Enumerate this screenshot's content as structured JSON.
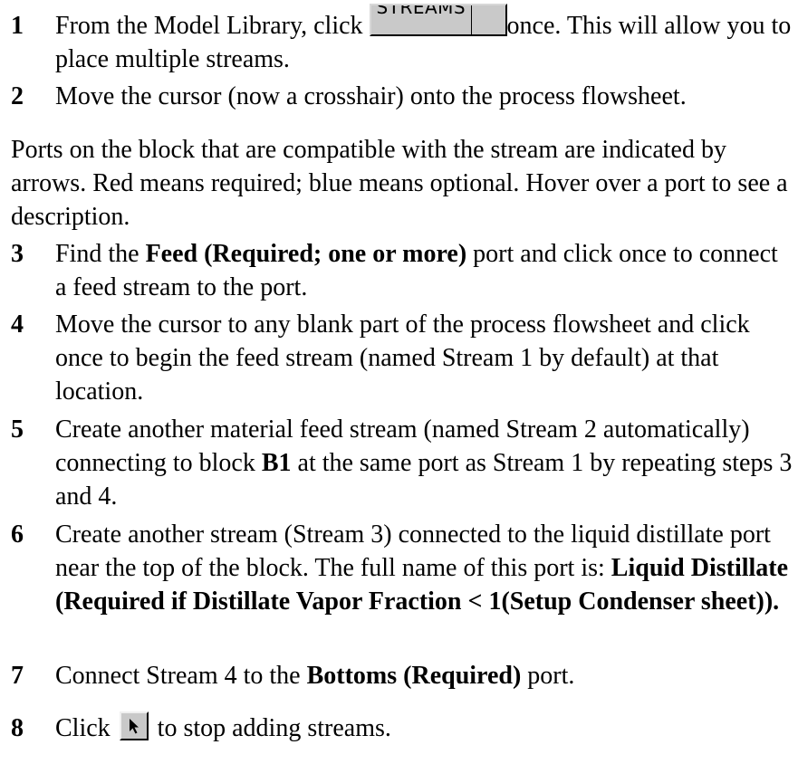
{
  "steps": [
    {
      "number": "1",
      "pre": "From the Model Library, click ",
      "button_label": "STREAMS",
      "post": "once. This will allow you to place multiple streams."
    },
    {
      "number": "2",
      "text": "Move the cursor (now a crosshair) onto the process flowsheet."
    },
    {
      "number": "3",
      "pre": "Find the ",
      "bold": "Feed (Required; one or more)",
      "post": " port and click once to connect a feed stream to the port."
    },
    {
      "number": "4",
      "text": "Move the cursor to any blank part of the process flowsheet and click once to begin the feed stream (named Stream 1 by default) at that location."
    },
    {
      "number": "5",
      "pre": "Create another material feed stream (named Stream 2 automatically) connecting to block ",
      "bold": "B1",
      "post": " at the same port as Stream 1 by repeating steps 3 and 4."
    },
    {
      "number": "6",
      "pre": "Create another stream (Stream 3) connected to the liquid distillate port near the top of the block. The full name of this port is: ",
      "bold": "Liquid Distillate (Required if Distillate Vapor Fraction < 1(Setup Condenser sheet))."
    },
    {
      "number": "7",
      "pre": "Connect Stream 4 to the ",
      "bold": "Bottoms (Required)",
      "post": " port."
    },
    {
      "number": "8",
      "pre": "Click ",
      "button_icon": "select-arrow-icon",
      "post": " to stop adding streams."
    }
  ],
  "note": "Ports on the block that are compatible with the stream are indicated by arrows. Red means required; blue means optional. Hover over a port to see a description."
}
